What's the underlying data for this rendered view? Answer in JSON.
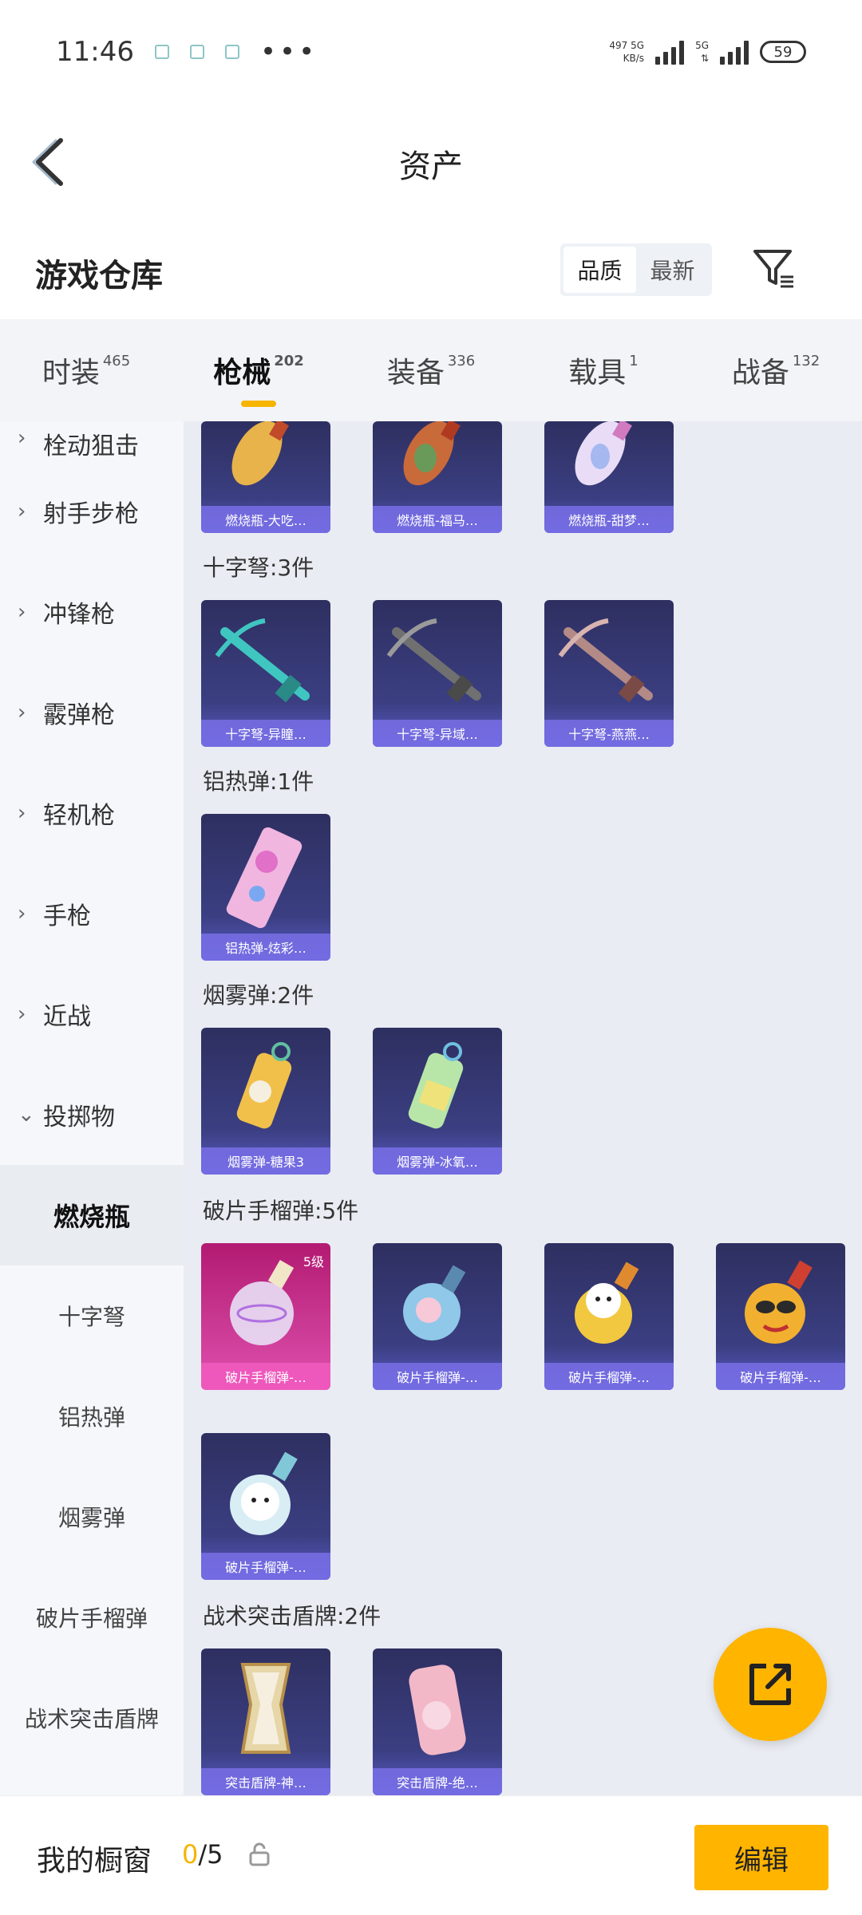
{
  "status_bar": {
    "time": "11:46",
    "net_speed_top": "497 5G",
    "net_speed_bottom": "KB/s",
    "network_label": "5G",
    "battery": "59"
  },
  "header": {
    "title": "资产"
  },
  "section": {
    "title": "游戏仓库",
    "sort_quality": "品质",
    "sort_newest": "最新"
  },
  "tabs": [
    {
      "label": "时装",
      "count": "465"
    },
    {
      "label": "枪械",
      "count": "202"
    },
    {
      "label": "装备",
      "count": "336"
    },
    {
      "label": "载具",
      "count": "1"
    },
    {
      "label": "战备",
      "count": "132"
    }
  ],
  "sidebar": {
    "categories": [
      "栓动狙击",
      "射手步枪",
      "冲锋枪",
      "霰弹枪",
      "轻机枪",
      "手枪",
      "近战",
      "投掷物"
    ],
    "subcategories": [
      "燃烧瓶",
      "十字弩",
      "铝热弹",
      "烟雾弹",
      "破片手榴弹",
      "战术突击盾牌"
    ]
  },
  "groups": [
    {
      "label": "",
      "items": [
        "燃烧瓶-大吃…",
        "燃烧瓶-福马…",
        "燃烧瓶-甜梦…"
      ]
    },
    {
      "label": "十字弩:3件",
      "items": [
        "十字弩-异瞳…",
        "十字弩-异域…",
        "十字弩-燕燕…"
      ]
    },
    {
      "label": "铝热弹:1件",
      "items": [
        "铝热弹-炫彩…"
      ]
    },
    {
      "label": "烟雾弹:2件",
      "items": [
        "烟雾弹-糖果3",
        "烟雾弹-冰氧…"
      ]
    },
    {
      "label": "破片手榴弹:5件",
      "items": [
        "破片手榴弹-…",
        "破片手榴弹-…",
        "破片手榴弹-…",
        "破片手榴弹-…",
        "破片手榴弹-…"
      ],
      "first_level": "5级"
    },
    {
      "label": "战术突击盾牌:2件",
      "items": [
        "突击盾牌-神…",
        "突击盾牌-绝…"
      ]
    }
  ],
  "bottom_bar": {
    "showcase_label": "我的橱窗",
    "showcase_current": "0",
    "showcase_total": "/5",
    "edit_label": "编辑"
  },
  "colors": {
    "accent": "#ffb400",
    "card_purple": "#3b3f82",
    "card_legend": "#cc3c96"
  }
}
